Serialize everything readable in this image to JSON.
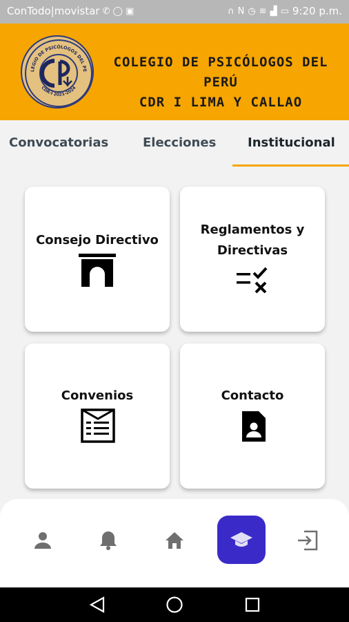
{
  "status_bar": {
    "carrier": "ConTodo|movistar",
    "time": "9:20 p.m."
  },
  "header": {
    "title_line1": "COLEGIO DE PSICÓLOGOS DEL PERÚ",
    "title_line2": "CDR I LIMA Y CALLAO",
    "logo_text_top": "COLEGIO DE PSICÓLOGOS DEL PERÚ",
    "logo_text_bottom": "CDR-I  2021-2024",
    "brand_color": "#f7a500"
  },
  "tabs": [
    {
      "label": "Convocatorias",
      "active": false
    },
    {
      "label": "Elecciones",
      "active": false
    },
    {
      "label": "Institucional",
      "active": true
    }
  ],
  "cards": [
    {
      "label_line1": "Consejo Directivo",
      "label_line2": "",
      "icon": "arch-icon"
    },
    {
      "label_line1": "Reglamentos y",
      "label_line2": "Directivas",
      "icon": "checklist-icon"
    },
    {
      "label_line1": "Convenios",
      "label_line2": "",
      "icon": "agreement-document-icon"
    },
    {
      "label_line1": "Contacto",
      "label_line2": "",
      "icon": "contact-card-icon"
    }
  ],
  "bottom_nav": [
    {
      "icon": "person-icon",
      "active": false
    },
    {
      "icon": "bell-icon",
      "active": false
    },
    {
      "icon": "home-icon",
      "active": false
    },
    {
      "icon": "graduation-cap-icon",
      "active": true
    },
    {
      "icon": "logout-icon",
      "active": false
    }
  ],
  "accent_color": "#3a2bc8"
}
